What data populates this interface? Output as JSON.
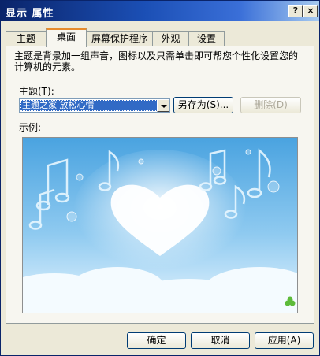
{
  "window": {
    "title": "显示 属性",
    "help_glyph": "?",
    "close_glyph": "×"
  },
  "tabs": [
    {
      "label": "主题"
    },
    {
      "label": "桌面"
    },
    {
      "label": "屏幕保护程序"
    },
    {
      "label": "外观"
    },
    {
      "label": "设置"
    }
  ],
  "active_tab": "桌面",
  "content": {
    "description": "主题是背景加一组声音，图标以及只需单击即可帮您个性化设置您的计算机的元素。",
    "theme_label": "主题(T):",
    "theme_selected": "主题之家 放松心情",
    "save_as_button": "另存为(S)...",
    "delete_button": "删除(D)",
    "sample_label": "示例:"
  },
  "footer": {
    "ok_button": "确定",
    "cancel_button": "取消",
    "apply_button": "应用(A)"
  },
  "colors": {
    "title_gradient_start": "#0a246a",
    "title_gradient_end": "#a6caf0",
    "dialog_bg": "#ece9d8",
    "selection_blue": "#316ac5",
    "active_tab_accent": "#e68b2c"
  },
  "icons": [
    "help-icon",
    "close-icon",
    "dropdown-arrow-icon",
    "clover-icon"
  ]
}
